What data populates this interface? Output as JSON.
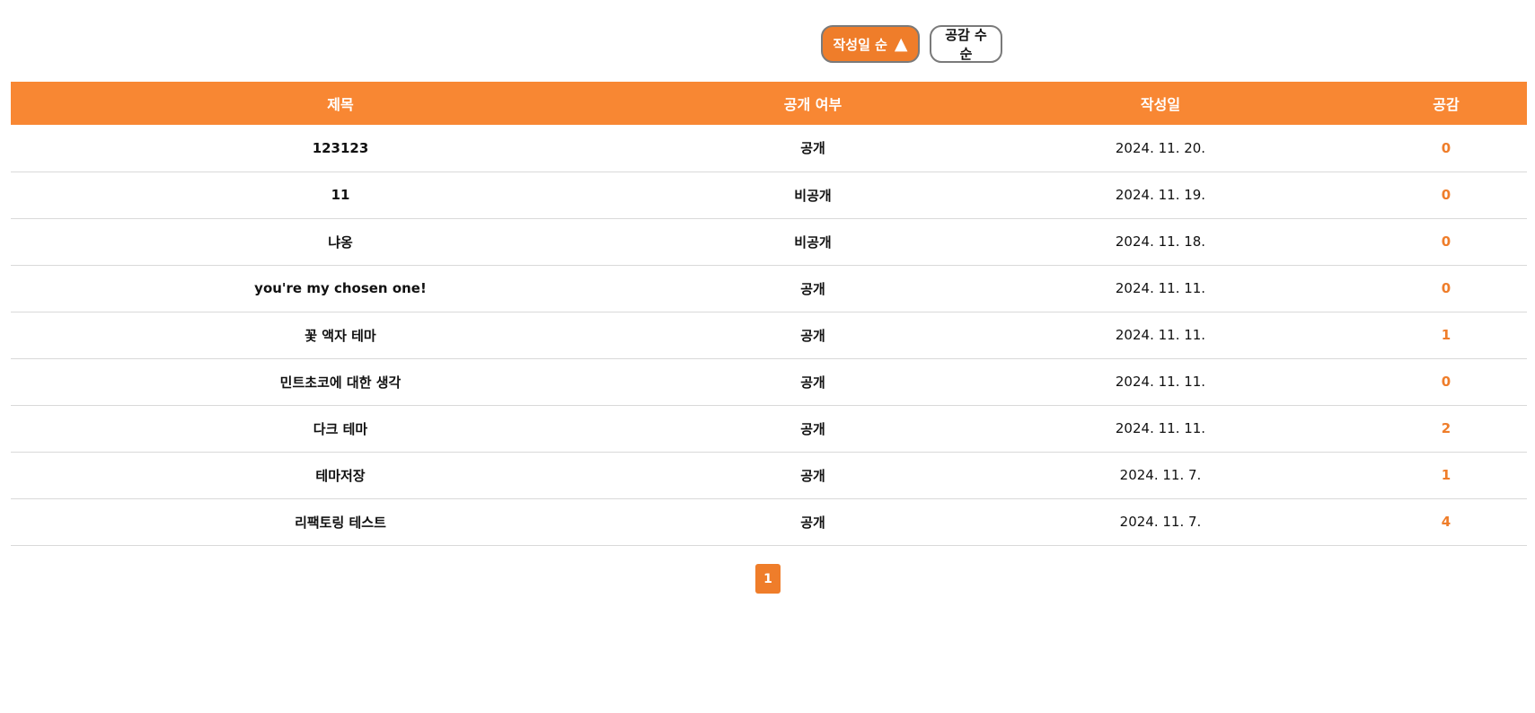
{
  "sort": {
    "by_date_label": "작성일 순",
    "by_date_arrow": "▲",
    "by_likes_label": "공감 수 순",
    "active_color": "#ef7d2a"
  },
  "table": {
    "headers": {
      "title": "제목",
      "public": "공개 여부",
      "date": "작성일",
      "likes": "공감"
    },
    "header_color": "#f88733",
    "rows": [
      {
        "title": "123123",
        "public": "공개",
        "date": "2024. 11. 20.",
        "likes": "0"
      },
      {
        "title": "11",
        "public": "비공개",
        "date": "2024. 11. 19.",
        "likes": "0"
      },
      {
        "title": "냐옹",
        "public": "비공개",
        "date": "2024. 11. 18.",
        "likes": "0"
      },
      {
        "title": "you're my chosen one!",
        "public": "공개",
        "date": "2024. 11. 11.",
        "likes": "0"
      },
      {
        "title": "꽃 액자 테마",
        "public": "공개",
        "date": "2024. 11. 11.",
        "likes": "1"
      },
      {
        "title": "민트초코에 대한 생각",
        "public": "공개",
        "date": "2024. 11. 11.",
        "likes": "0"
      },
      {
        "title": "다크 테마",
        "public": "공개",
        "date": "2024. 11. 11.",
        "likes": "2"
      },
      {
        "title": "테마저장",
        "public": "공개",
        "date": "2024. 11. 7.",
        "likes": "1"
      },
      {
        "title": "리팩토링 테스트",
        "public": "공개",
        "date": "2024. 11. 7.",
        "likes": "4"
      }
    ]
  },
  "pagination": {
    "current_page": "1"
  }
}
